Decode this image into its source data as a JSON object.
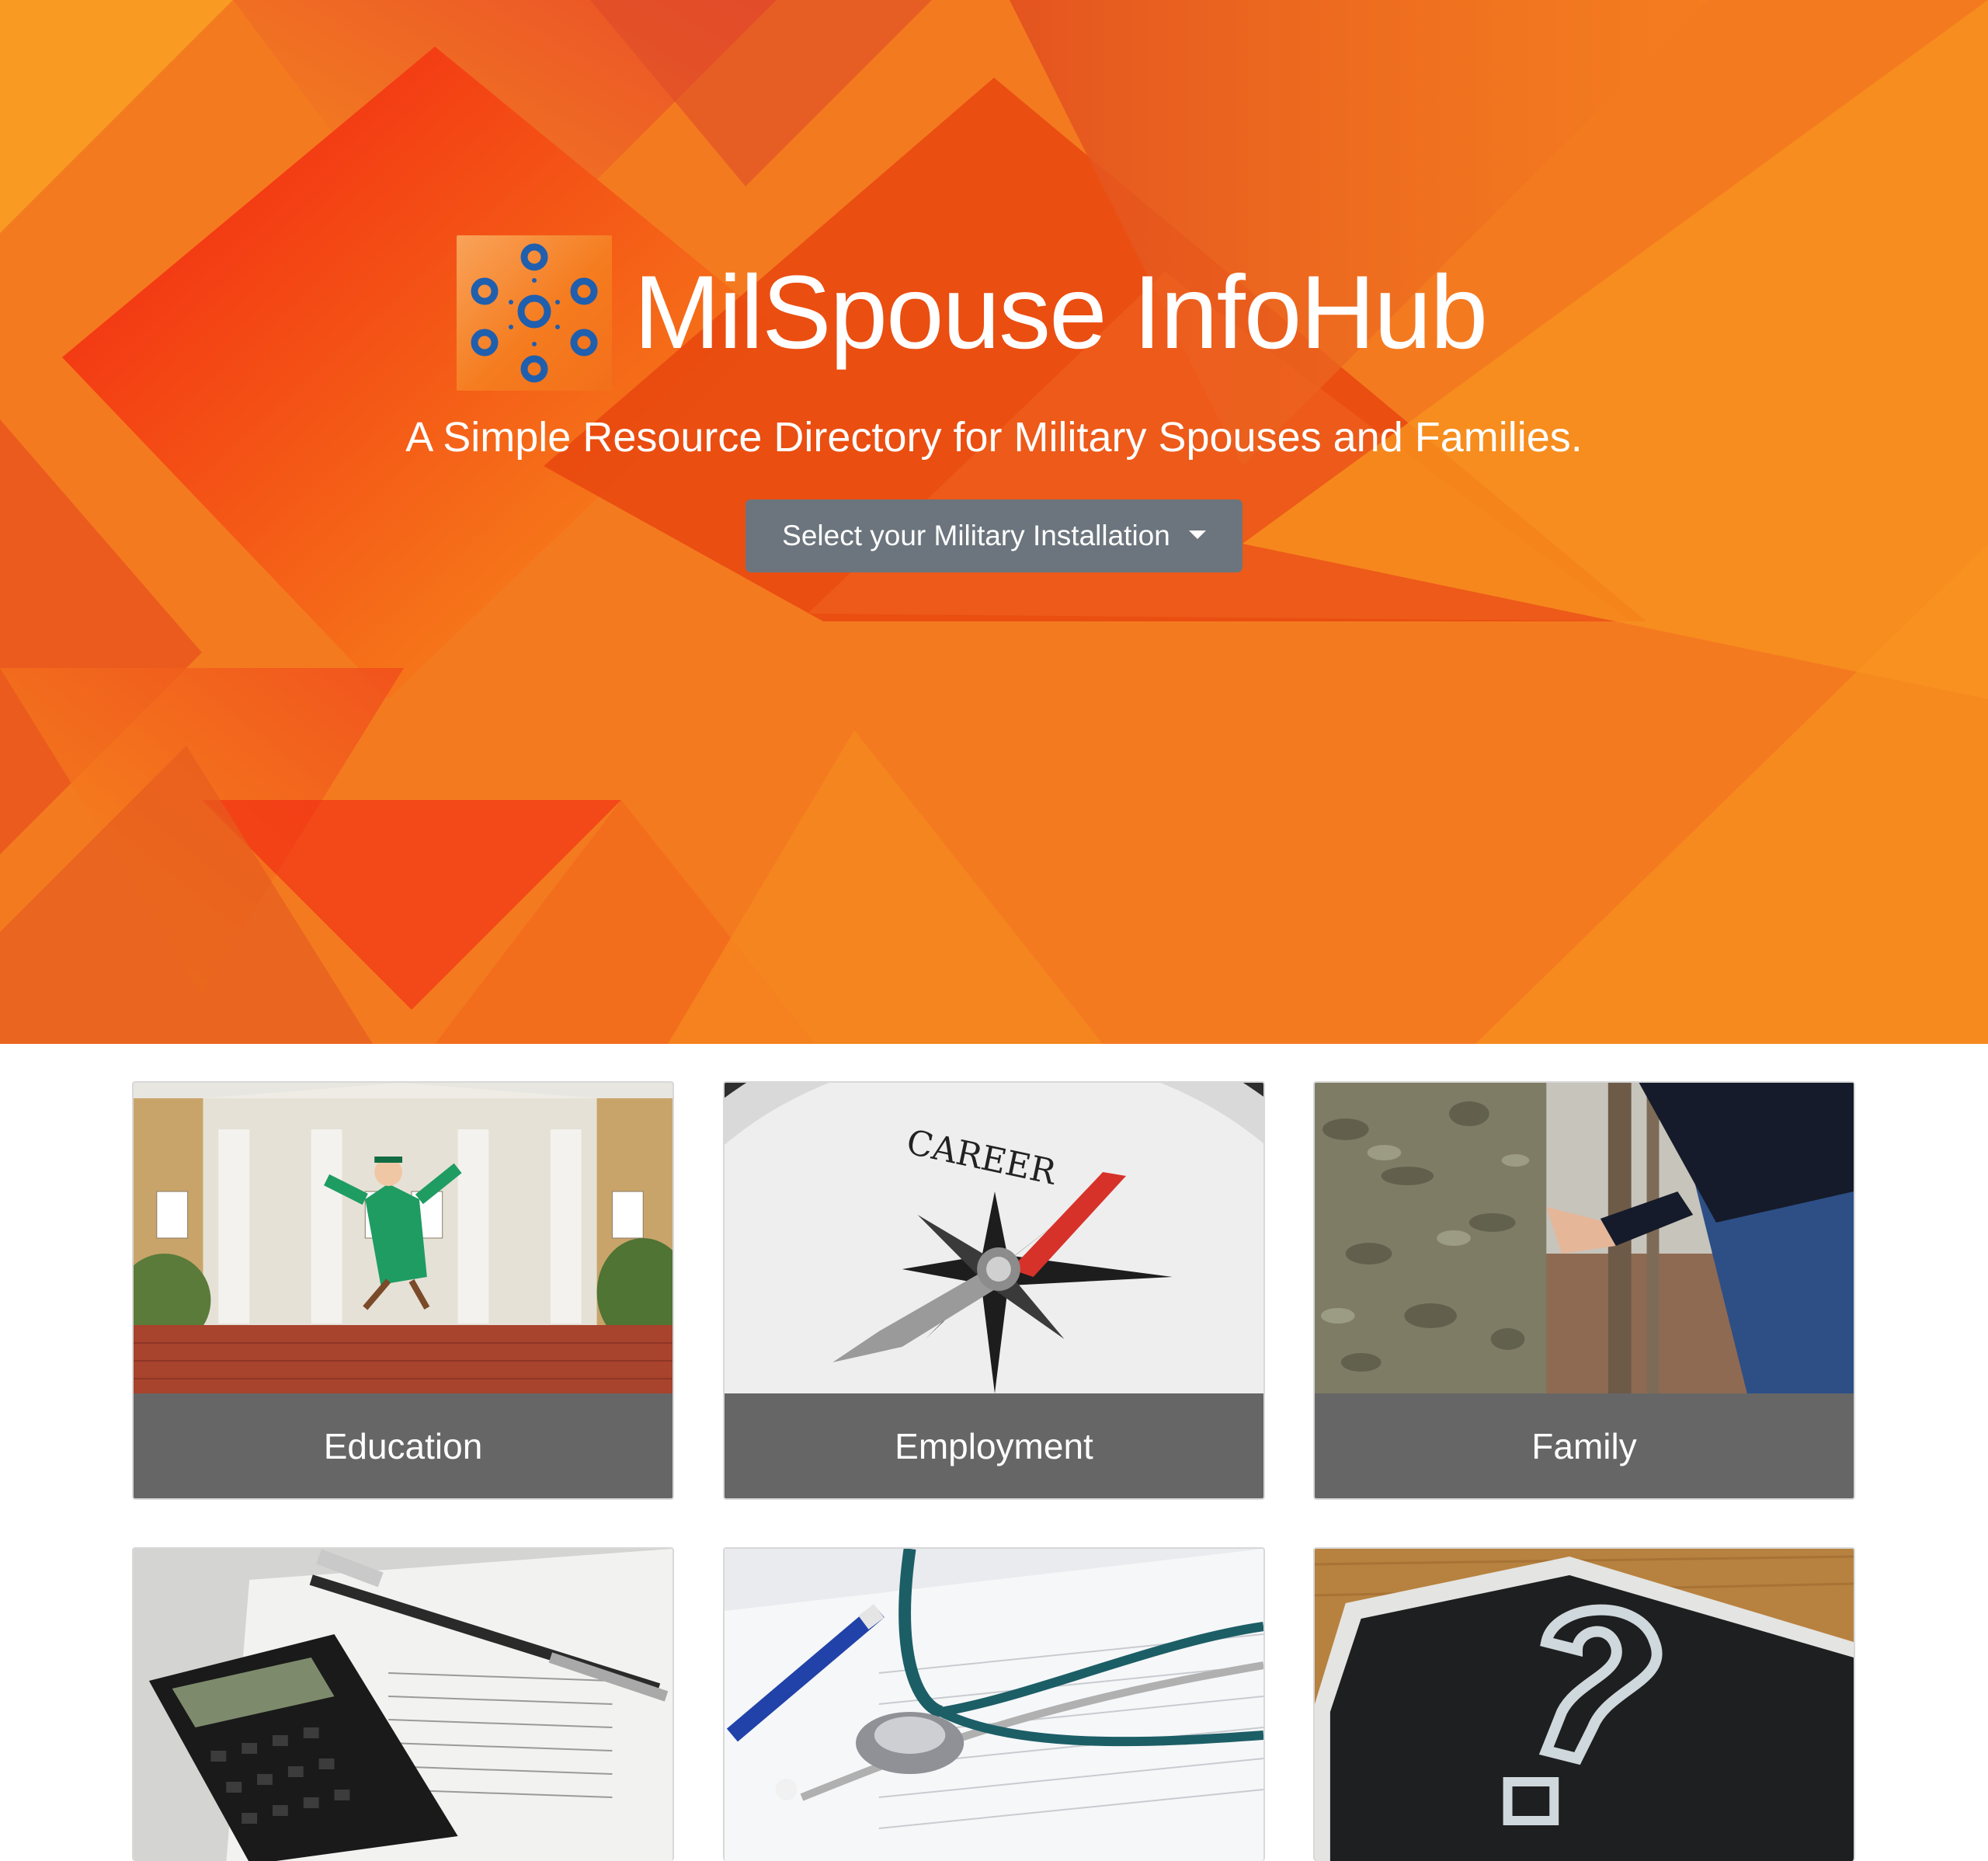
{
  "brand": {
    "title": "MilSpouse InfoHub",
    "tagline": "A Simple Resource Directory for Military Spouses and Families."
  },
  "installation_dropdown": {
    "label": "Select your Military Installation"
  },
  "categories": [
    {
      "label": "Education",
      "image": "graduate-jumping-photo"
    },
    {
      "label": "Employment",
      "image": "career-compass-photo"
    },
    {
      "label": "Family",
      "image": "holding-hands-photo"
    },
    {
      "label": "",
      "image": "calculator-finance-photo"
    },
    {
      "label": "",
      "image": "stethoscope-health-photo"
    },
    {
      "label": "",
      "image": "question-mark-chalkboard-photo"
    }
  ],
  "colors": {
    "hero_orange": "#f26522",
    "hero_red": "#f21f10",
    "button_gray": "#6c757d",
    "card_label_gray": "#666666",
    "logo_blue": "#1f5fae"
  },
  "compass_text": "CAREER"
}
